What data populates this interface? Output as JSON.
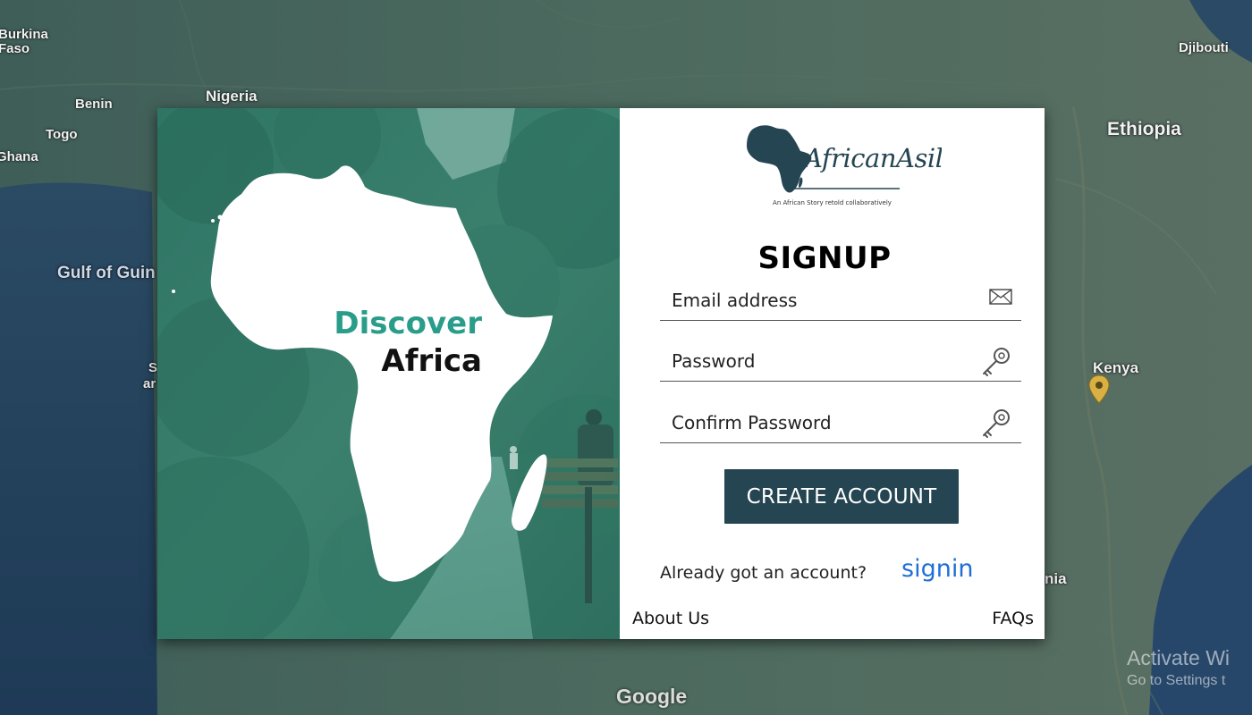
{
  "map": {
    "labels": {
      "burkina_faso": "Burkina\nFaso",
      "benin": "Benin",
      "togo": "Togo",
      "ghana": "Ghana",
      "nigeria": "Nigeria",
      "gulf_of_guinea": "Gulf of Guin",
      "djibouti": "Djibouti",
      "ethiopia": "Ethiopia",
      "kenya": "Kenya",
      "tanzania_fragment": "nia",
      "left_fragment_1": "S",
      "left_fragment_2": "ar"
    },
    "attribution": "Google",
    "watermark": {
      "line1": "Activate Wi",
      "line2": "Go to Settings t"
    }
  },
  "hero": {
    "line1": "Discover",
    "line2": "Africa",
    "accent_color": "#2a9d8a"
  },
  "brand": {
    "name": "AfricanAsili",
    "tagline": "An African Story retold collaboratively"
  },
  "signup": {
    "title": "SIGNUP",
    "email_placeholder": "Email address",
    "password_placeholder": "Password",
    "confirm_placeholder": "Confirm Password",
    "create_button": "CREATE ACCOUNT",
    "button_color": "#254552",
    "already_text": "Already got an account?",
    "signin_link": "signin",
    "link_color": "#1f6fd6"
  },
  "footer": {
    "about": "About Us",
    "faqs": "FAQs"
  },
  "icons": {
    "email": "envelope-icon",
    "password": "key-icon",
    "confirm": "key-icon",
    "map_pin": "map-pin-icon"
  }
}
